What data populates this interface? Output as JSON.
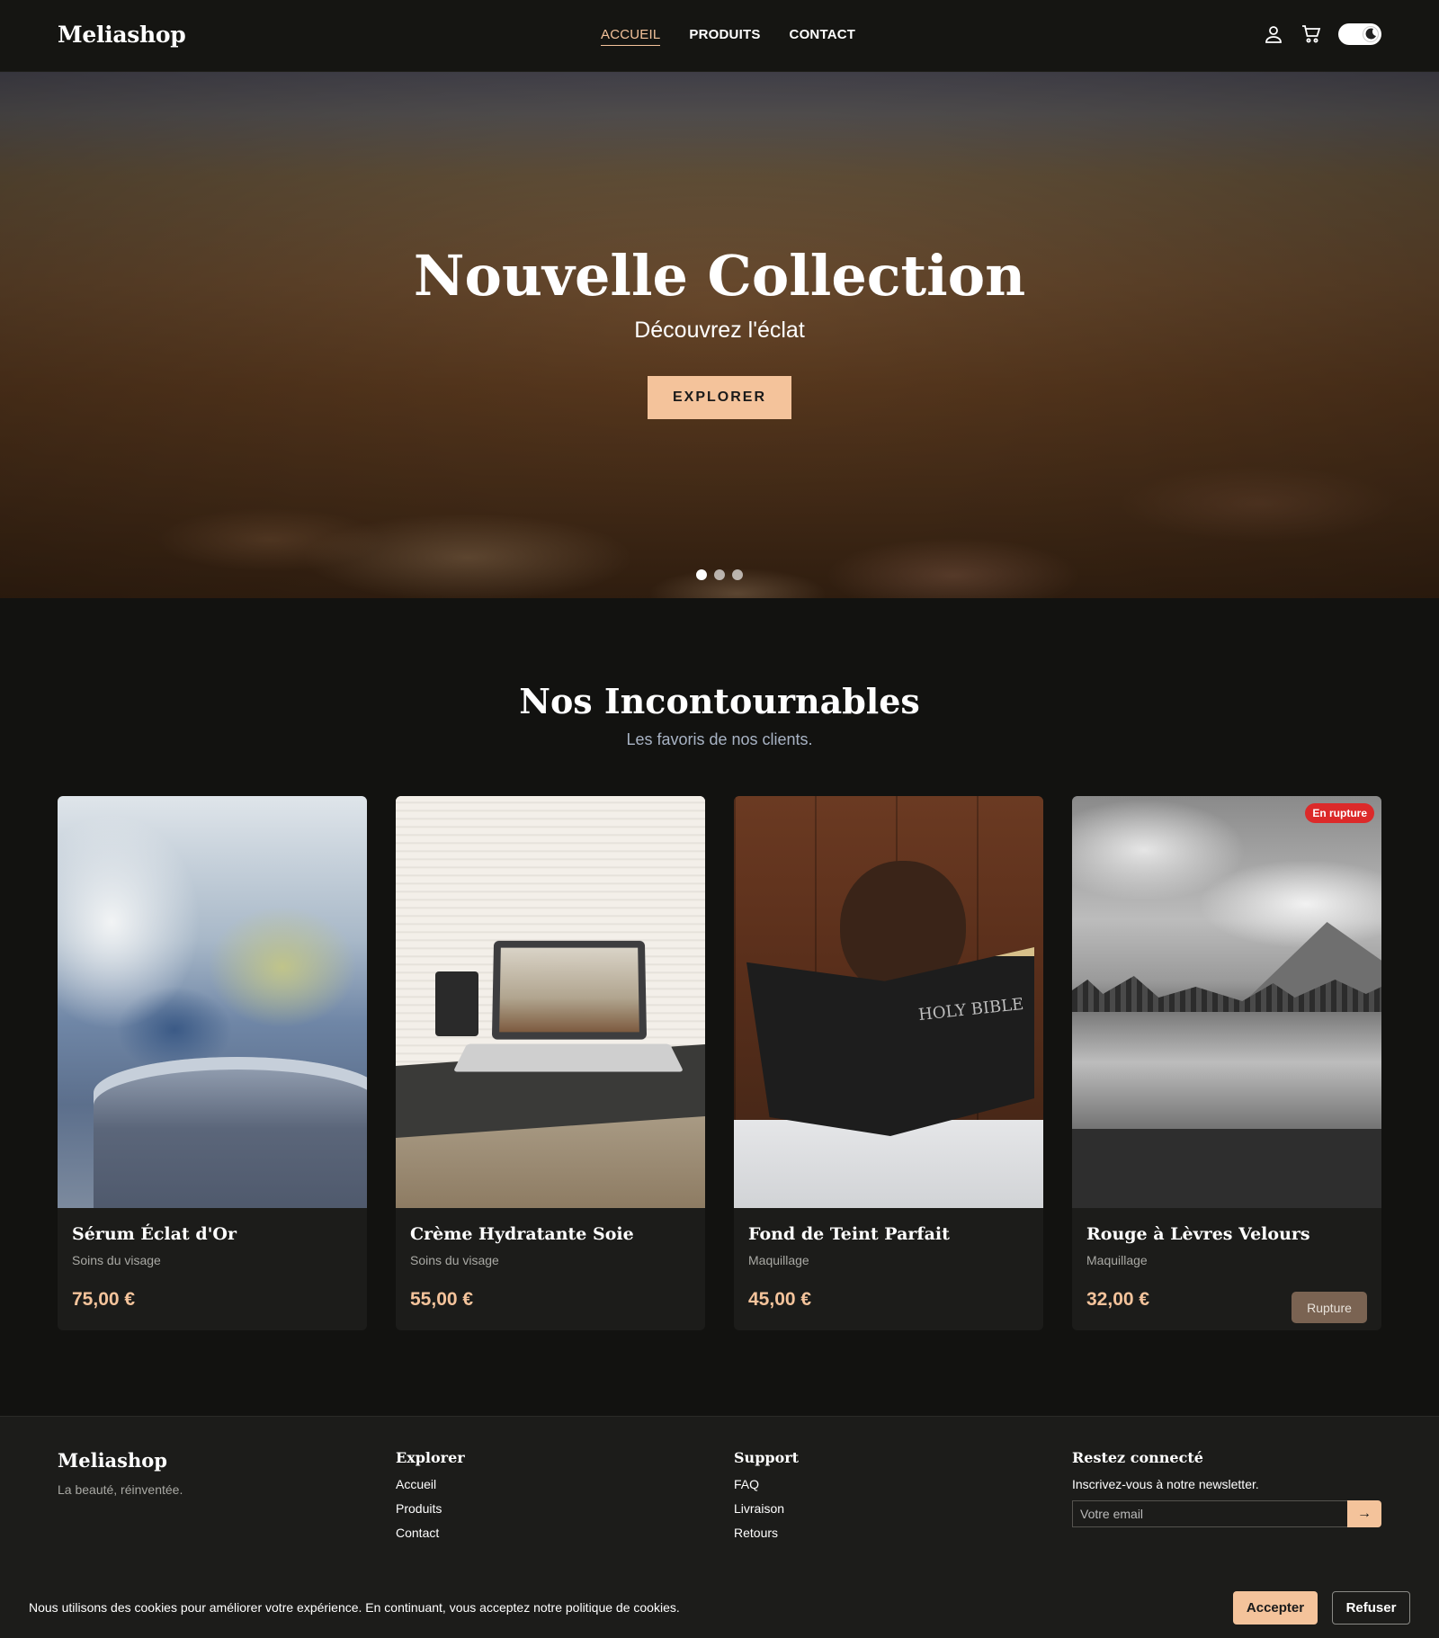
{
  "header": {
    "logo": "Meliashop",
    "nav": [
      {
        "label": "ACCUEIL"
      },
      {
        "label": "PRODUITS"
      },
      {
        "label": "CONTACT"
      }
    ],
    "icons": [
      "user-icon",
      "cart-icon",
      "theme-toggle-moon-icon"
    ]
  },
  "hero": {
    "title": "Nouvelle Collection",
    "subtitle": "Découvrez l'éclat",
    "button": "EXPLORER",
    "slides_count": 3,
    "active_slide": 1
  },
  "section": {
    "title": "Nos Incontournables",
    "subtitle": "Les favoris de nos clients."
  },
  "products": [
    {
      "name": "Sérum Éclat d'Or",
      "category": "Soins du visage",
      "price": "75,00 €"
    },
    {
      "name": "Crème Hydratante Soie",
      "category": "Soins du visage",
      "price": "55,00 €"
    },
    {
      "name": "Fond de Teint Parfait",
      "category": "Maquillage",
      "price": "45,00 €",
      "image_text": "HOLY BIBLE"
    },
    {
      "name": "Rouge à Lèvres Velours",
      "category": "Maquillage",
      "price": "32,00 €",
      "badge": "En rupture",
      "button": "Rupture"
    }
  ],
  "footer": {
    "brand": "Meliashop",
    "tagline": "La beauté, réinventée.",
    "explore": {
      "title": "Explorer",
      "links": [
        "Accueil",
        "Produits",
        "Contact"
      ]
    },
    "support": {
      "title": "Support",
      "links": [
        "FAQ",
        "Livraison",
        "Retours"
      ]
    },
    "newsletter": {
      "title": "Restez connecté",
      "text": "Inscrivez-vous à notre newsletter.",
      "placeholder": "Votre email",
      "submit": "→"
    }
  },
  "cookie": {
    "text": "Nous utilisons des cookies pour améliorer votre expérience. En continuant, vous acceptez notre politique de cookies.",
    "accept": "Accepter",
    "refuse": "Refuser"
  },
  "colors": {
    "accent": "#f4c39b",
    "background": "#121210",
    "danger": "#dc2a2a"
  }
}
